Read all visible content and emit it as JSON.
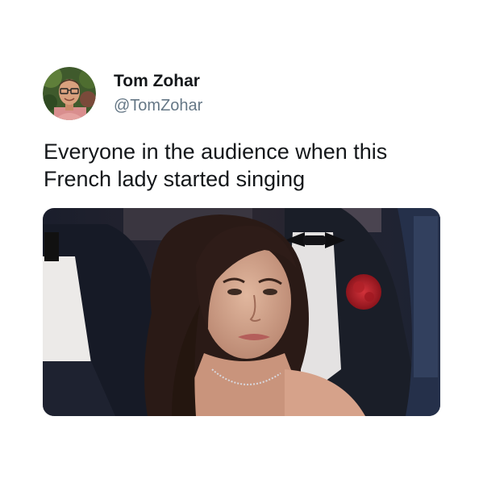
{
  "tweet": {
    "author": {
      "display_name": "Tom Zohar",
      "handle": "@TomZohar",
      "avatar_icon": "profile-photo"
    },
    "text_lines": [
      "Everyone in the audience when this",
      "French lady started singing"
    ],
    "media": {
      "type": "photo",
      "icon": "audience-photo"
    }
  },
  "colors": {
    "background": "#ffffff",
    "name_text": "#14171a",
    "handle_text": "#657786",
    "body_text": "#14171a"
  }
}
